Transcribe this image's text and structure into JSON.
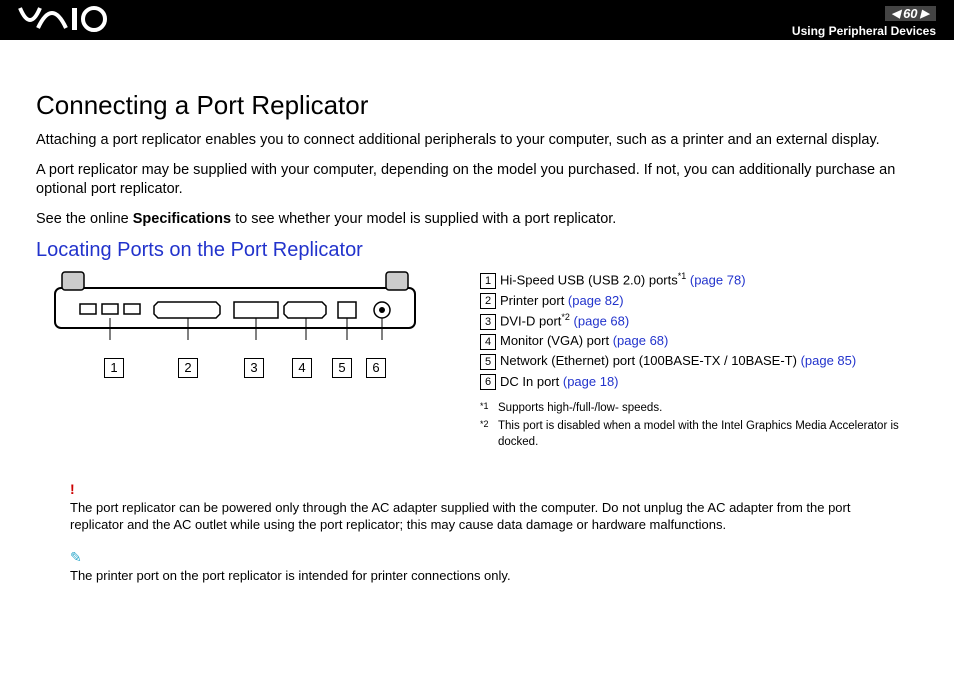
{
  "header": {
    "logo": "VAIO",
    "page_number": "60",
    "section_title": "Using Peripheral Devices"
  },
  "title": "Connecting a Port Replicator",
  "para1": "Attaching a port replicator enables you to connect additional peripherals to your computer, such as a printer and an external display.",
  "para2": "A port replicator may be supplied with your computer, depending on the model you purchased. If not, you can additionally purchase an optional port replicator.",
  "para3_pre": "See the online ",
  "para3_bold": "Specifications",
  "para3_post": " to see whether your model is supplied with a port replicator.",
  "subtitle": "Locating Ports on the Port Replicator",
  "legend": [
    {
      "num": "1",
      "text": "Hi-Speed USB (USB 2.0) ports",
      "sup": "*1",
      "link": "(page 78)"
    },
    {
      "num": "2",
      "text": "Printer port ",
      "sup": "",
      "link": "(page 82)"
    },
    {
      "num": "3",
      "text": "DVI-D port",
      "sup": "*2",
      "link": "(page 68)"
    },
    {
      "num": "4",
      "text": "Monitor (VGA) port ",
      "sup": "",
      "link": "(page 68)"
    },
    {
      "num": "5",
      "text": "Network (Ethernet) port (100BASE-TX / 10BASE-T) ",
      "sup": "",
      "link": "(page 85)"
    },
    {
      "num": "6",
      "text": "DC In port ",
      "sup": "",
      "link": "(page 18)"
    }
  ],
  "footnotes": [
    {
      "mark": "*1",
      "text": "Supports high-/full-/low- speeds."
    },
    {
      "mark": "*2",
      "text": "This port is disabled when a model with the Intel Graphics Media Accelerator is docked."
    }
  ],
  "warning": "The port replicator can be powered only through the AC adapter supplied with the computer. Do not unplug the AC adapter from the port replicator and the AC outlet while using the port replicator; this may cause data damage or hardware malfunctions.",
  "note": "The printer port on the port replicator is intended for printer connections only.",
  "callout_nums": [
    "1",
    "2",
    "3",
    "4",
    "5",
    "6"
  ]
}
